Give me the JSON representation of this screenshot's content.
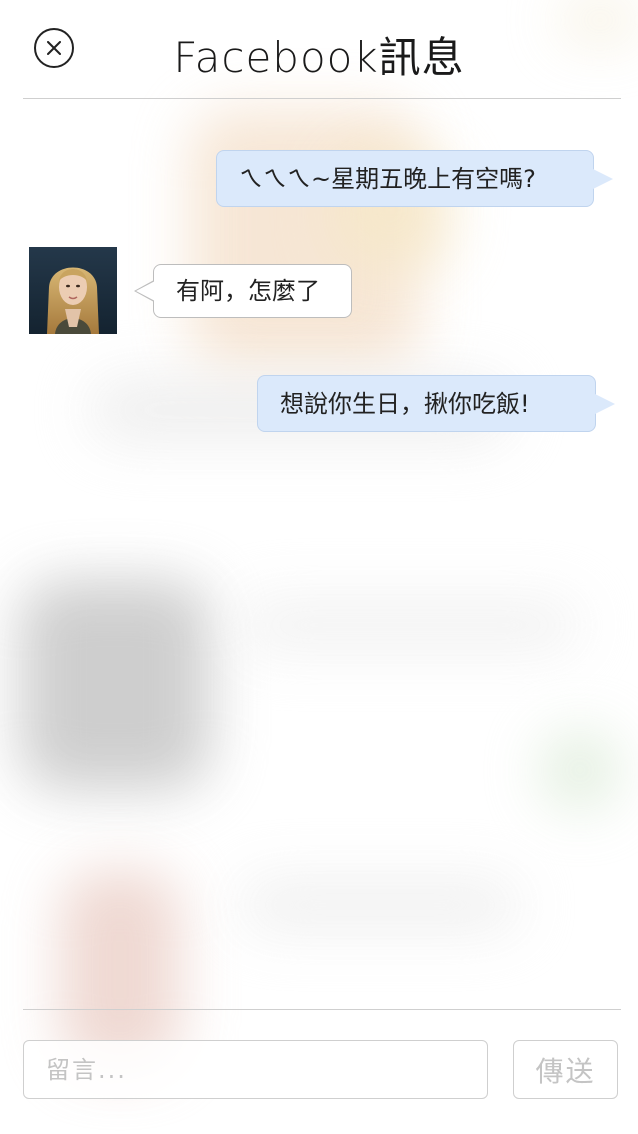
{
  "header": {
    "title": "Facebook訊息",
    "close_icon": "close-icon"
  },
  "messages": [
    {
      "direction": "outgoing",
      "text": "ㄟㄟㄟ~星期五晚上有空嗎?"
    },
    {
      "direction": "incoming",
      "text": "有阿，怎麼了",
      "avatar": "avatar"
    },
    {
      "direction": "outgoing",
      "text": "想說你生日，揪你吃飯!"
    }
  ],
  "composer": {
    "placeholder": "留言...",
    "value": "",
    "send_label": "傳送"
  },
  "colors": {
    "outgoing_bubble": "#dbe9fb",
    "outgoing_border": "#c0d4ee",
    "incoming_bubble": "#ffffff",
    "incoming_border": "#bdbdbd",
    "divider": "#cfcfcf",
    "placeholder": "#c4c4c4"
  }
}
